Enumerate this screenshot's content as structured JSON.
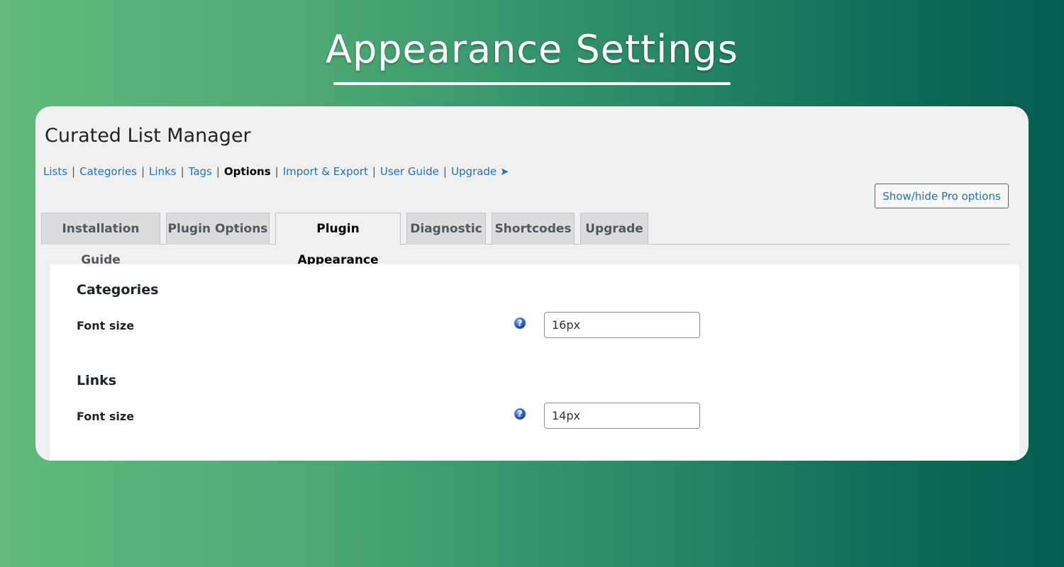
{
  "hero": {
    "title": "Appearance Settings"
  },
  "app": {
    "title": "Curated List Manager",
    "subnav": [
      {
        "label": "Lists",
        "current": false
      },
      {
        "label": "Categories",
        "current": false
      },
      {
        "label": "Links",
        "current": false
      },
      {
        "label": "Tags",
        "current": false
      },
      {
        "label": "Options",
        "current": true
      },
      {
        "label": "Import & Export",
        "current": false
      },
      {
        "label": "User Guide",
        "current": false
      },
      {
        "label": "Upgrade ➤",
        "current": false
      }
    ],
    "separator": "|",
    "pro_button": "Show/hide Pro options",
    "tabs": [
      {
        "label": "Installation Guide",
        "active": false
      },
      {
        "label": "Plugin Options",
        "active": false
      },
      {
        "label": "Plugin Appearance",
        "active": true
      },
      {
        "label": "Diagnostic",
        "active": false
      },
      {
        "label": "Shortcodes",
        "active": false
      },
      {
        "label": "Upgrade",
        "active": false
      }
    ],
    "sections": [
      {
        "title": "Categories",
        "field_label": "Font size",
        "value": "16px",
        "help_icon": "question-icon"
      },
      {
        "title": "Links",
        "field_label": "Font size",
        "value": "14px",
        "help_icon": "question-icon"
      }
    ]
  },
  "colors": {
    "link": "#2271b1",
    "panel_bg": "#f0f0f1",
    "tab_bg": "#dcdcde",
    "help_icon": "#2a64c8"
  }
}
